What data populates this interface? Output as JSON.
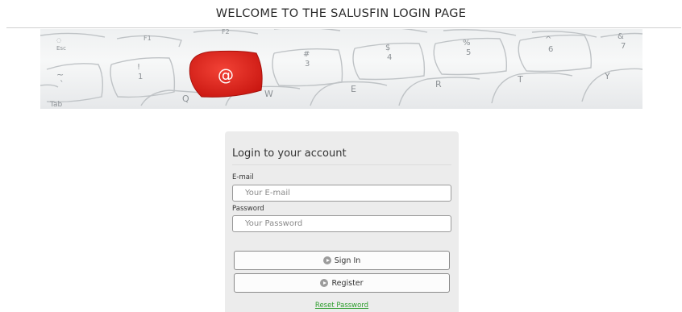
{
  "header": {
    "title": "WELCOME TO THE SALUSFIN LOGIN PAGE"
  },
  "banner": {
    "image": "keyboard-at-key-banner",
    "keys": {
      "esc": "Esc",
      "f1": "F1",
      "f2": "F2",
      "at": "@",
      "num1_top": "!",
      "num1": "1",
      "num3_top": "#",
      "num3": "3",
      "num4_top": "$",
      "num4": "4",
      "num5_top": "%",
      "num5": "5",
      "num6_top": "^",
      "num6": "6",
      "num7_top": "&",
      "num7": "7",
      "tilde_top": "~",
      "tilde": "`",
      "tab": "Tab",
      "q": "Q",
      "w": "W",
      "e": "E",
      "r": "R",
      "t": "T",
      "y": "Y"
    },
    "accent_key_color": "#e02b20"
  },
  "login": {
    "heading": "Login to your account",
    "email_label": "E-mail",
    "email_placeholder": "Your E-mail",
    "email_value": "",
    "password_label": "Password",
    "password_placeholder": "Your Password",
    "password_value": "",
    "signin_label": "Sign In",
    "register_label": "Register",
    "reset_label": "Reset Password",
    "button_icon": "play-circle-icon",
    "link_color": "#2e9e2e"
  }
}
